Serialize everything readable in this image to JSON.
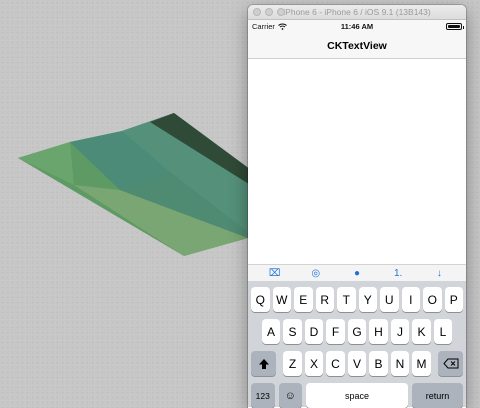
{
  "window": {
    "title": "iPhone 6 - iPhone 6 / iOS 9.1 (13B143)"
  },
  "status": {
    "carrier": "Carrier",
    "time": "11:46 AM",
    "battery_level": 1.0
  },
  "navbar": {
    "title": "CKTextView"
  },
  "accessory": [
    "⌧",
    "◎",
    "●",
    "1.",
    "↓"
  ],
  "keyboard": {
    "row1": [
      "Q",
      "W",
      "E",
      "R",
      "T",
      "Y",
      "U",
      "I",
      "O",
      "P"
    ],
    "row2": [
      "A",
      "S",
      "D",
      "F",
      "G",
      "H",
      "J",
      "K",
      "L"
    ],
    "row3": [
      "Z",
      "X",
      "C",
      "V",
      "B",
      "N",
      "M"
    ],
    "numbers_label": "123",
    "space_label": "space",
    "return_label": "return"
  },
  "colors": {
    "accent": "#1e73d9",
    "keyboard_bg": "#d1d4d9",
    "desktop_bg": "#c6c6c6"
  }
}
